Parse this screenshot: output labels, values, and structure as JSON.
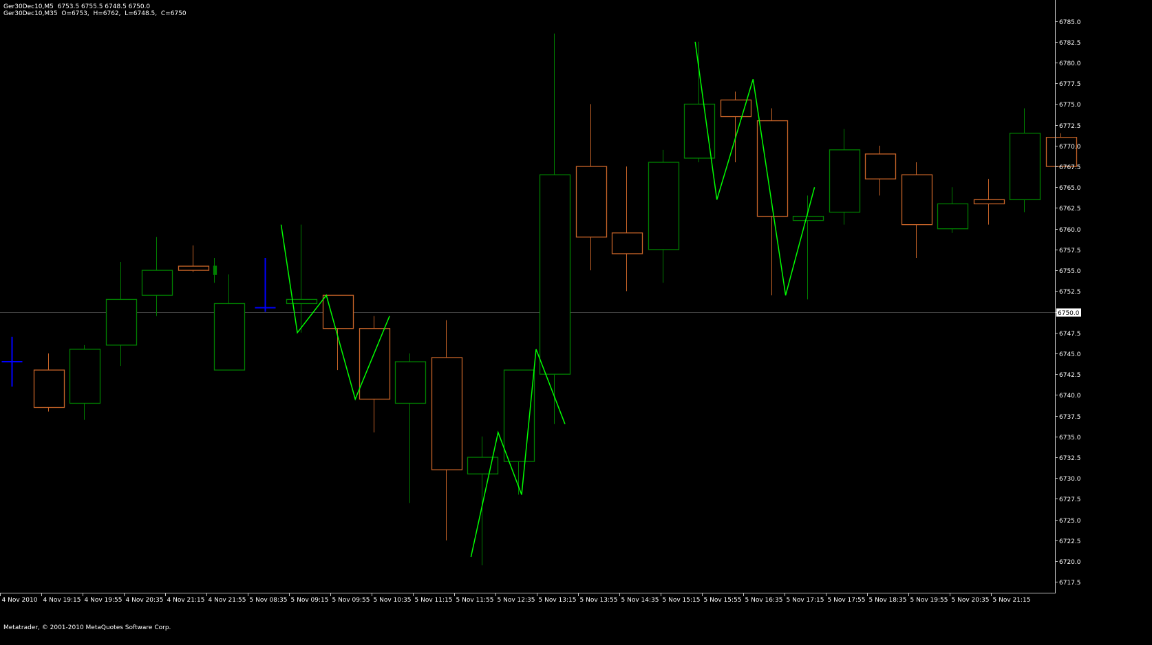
{
  "header": {
    "line1": "Ger30Dec10,M5  6753.5 6755.5 6748.5 6750.0",
    "line2": "Ger30Dec10,M35  O=6753,  H=6762,  L=6748.5,  C=6750"
  },
  "footer": {
    "copyright": "Metatrader, © 2001-2010 MetaQuotes Software Corp."
  },
  "colors": {
    "background": "#000000",
    "bull": "#008000",
    "bear": "#C86428",
    "current_bar": "#0000FF",
    "zigzag": "#00FF00",
    "axis": "#C0C0C0",
    "price_line": "#404040",
    "label_bg": "#FFFFFF",
    "label_text": "#000000"
  },
  "chart_data": {
    "type": "candlestick",
    "symbol": "Ger30Dec10",
    "timeframe": "M35",
    "ylim": [
      6716.2,
      6787.2
    ],
    "current_price": "6750.0",
    "current_price_value": 6750.0,
    "y_ticks": [
      "6717.5",
      "6720.0",
      "6722.5",
      "6725.0",
      "6727.5",
      "6730.0",
      "6732.5",
      "6735.0",
      "6737.5",
      "6740.0",
      "6742.5",
      "6745.0",
      "6747.5",
      "6750.0",
      "6752.5",
      "6755.0",
      "6757.5",
      "6760.0",
      "6762.5",
      "6765.0",
      "6767.5",
      "6770.0",
      "6772.5",
      "6775.0",
      "6777.5",
      "6780.0",
      "6782.5",
      "6785.0"
    ],
    "x_ticks": [
      "4 Nov 2010",
      "4 Nov 19:15",
      "4 Nov 19:55",
      "4 Nov 20:35",
      "4 Nov 21:15",
      "4 Nov 21:55",
      "5 Nov 08:35",
      "5 Nov 09:15",
      "5 Nov 09:55",
      "5 Nov 10:35",
      "5 Nov 11:15",
      "5 Nov 11:55",
      "5 Nov 12:35",
      "5 Nov 13:15",
      "5 Nov 13:55",
      "5 Nov 14:35",
      "5 Nov 15:15",
      "5 Nov 15:55",
      "5 Nov 16:35",
      "5 Nov 17:15",
      "5 Nov 17:55",
      "5 Nov 18:35",
      "5 Nov 19:55",
      "5 Nov 20:35",
      "5 Nov 21:15"
    ],
    "candles": [
      {
        "i": 0,
        "o": 6744,
        "h": 6747,
        "l": 6741,
        "c": 6744,
        "kind": "current"
      },
      {
        "i": 1,
        "o": 6743,
        "h": 6745,
        "l": 6738,
        "c": 6738.5
      },
      {
        "i": 2,
        "o": 6739,
        "h": 6746,
        "l": 6737,
        "c": 6745.5
      },
      {
        "i": 3,
        "o": 6746,
        "h": 6756,
        "l": 6743.5,
        "c": 6751.5
      },
      {
        "i": 4,
        "o": 6752,
        "h": 6759,
        "l": 6749.5,
        "c": 6755
      },
      {
        "i": 5,
        "o": 6755.5,
        "h": 6758,
        "l": 6754.8,
        "c": 6755
      },
      {
        "i": 5.6,
        "o": 6754.5,
        "h": 6756.5,
        "l": 6753.5,
        "c": 6755.5,
        "kind": "thin"
      },
      {
        "i": 6,
        "o": 6743,
        "h": 6754.5,
        "l": 6743,
        "c": 6751
      },
      {
        "i": 7,
        "o": 6750.5,
        "h": 6756.5,
        "l": 6750,
        "c": 6750.5,
        "kind": "current"
      },
      {
        "i": 8,
        "o": 6751,
        "h": 6760.5,
        "l": 6747.5,
        "c": 6751.5
      },
      {
        "i": 9,
        "o": 6752,
        "h": 6752,
        "l": 6743,
        "c": 6748
      },
      {
        "i": 10,
        "o": 6748,
        "h": 6749.5,
        "l": 6735.5,
        "c": 6739.5
      },
      {
        "i": 11,
        "o": 6739,
        "h": 6745,
        "l": 6727,
        "c": 6744
      },
      {
        "i": 12,
        "o": 6744.5,
        "h": 6749,
        "l": 6722.5,
        "c": 6731
      },
      {
        "i": 13,
        "o": 6730.5,
        "h": 6735,
        "l": 6719.5,
        "c": 6732.5
      },
      {
        "i": 14,
        "o": 6732,
        "h": 6735,
        "l": 6728,
        "c": 6743
      },
      {
        "i": 15,
        "o": 6742.5,
        "h": 6783.5,
        "l": 6736.5,
        "c": 6766.5
      },
      {
        "i": 16,
        "o": 6767.5,
        "h": 6775,
        "l": 6755,
        "c": 6759
      },
      {
        "i": 17,
        "o": 6759.5,
        "h": 6767.5,
        "l": 6752.5,
        "c": 6757
      },
      {
        "i": 18,
        "o": 6757.5,
        "h": 6769.5,
        "l": 6753.5,
        "c": 6768
      },
      {
        "i": 19,
        "o": 6768.5,
        "h": 6782.5,
        "l": 6768,
        "c": 6775
      },
      {
        "i": 20,
        "o": 6775.5,
        "h": 6776.5,
        "l": 6768,
        "c": 6773.5
      },
      {
        "i": 21,
        "o": 6773,
        "h": 6774.5,
        "l": 6752,
        "c": 6761.5
      },
      {
        "i": 22,
        "o": 6761,
        "h": 6764,
        "l": 6751.5,
        "c": 6761.5
      },
      {
        "i": 23,
        "o": 6762,
        "h": 6772,
        "l": 6760.5,
        "c": 6769.5
      },
      {
        "i": 24,
        "o": 6769,
        "h": 6770,
        "l": 6764,
        "c": 6766
      },
      {
        "i": 25,
        "o": 6766.5,
        "h": 6768,
        "l": 6756.5,
        "c": 6760.5
      },
      {
        "i": 26,
        "o": 6760,
        "h": 6765,
        "l": 6759.5,
        "c": 6763
      },
      {
        "i": 27,
        "o": 6763.5,
        "h": 6766,
        "l": 6760.5,
        "c": 6763
      },
      {
        "i": 28,
        "o": 6763.5,
        "h": 6774.5,
        "l": 6762,
        "c": 6771.5
      },
      {
        "i": 29,
        "o": 6771,
        "h": 6771.5,
        "l": 6767.5,
        "c": 6767.5
      }
    ],
    "zigzag_segments": [
      [
        [
          7.45,
          6760.5
        ],
        [
          7.9,
          6747.5
        ],
        [
          8.7,
          6752
        ],
        [
          9.5,
          6739.5
        ],
        [
          10.45,
          6749.5
        ]
      ],
      [
        [
          12.7,
          6720.5
        ],
        [
          13.45,
          6735.5
        ],
        [
          14.1,
          6728
        ],
        [
          14.5,
          6745.5
        ],
        [
          15.3,
          6736.5
        ]
      ],
      [
        [
          18.9,
          6782.5
        ],
        [
          19.5,
          6763.5
        ],
        [
          20.5,
          6778
        ],
        [
          21.4,
          6752
        ],
        [
          22.2,
          6765
        ]
      ]
    ]
  }
}
